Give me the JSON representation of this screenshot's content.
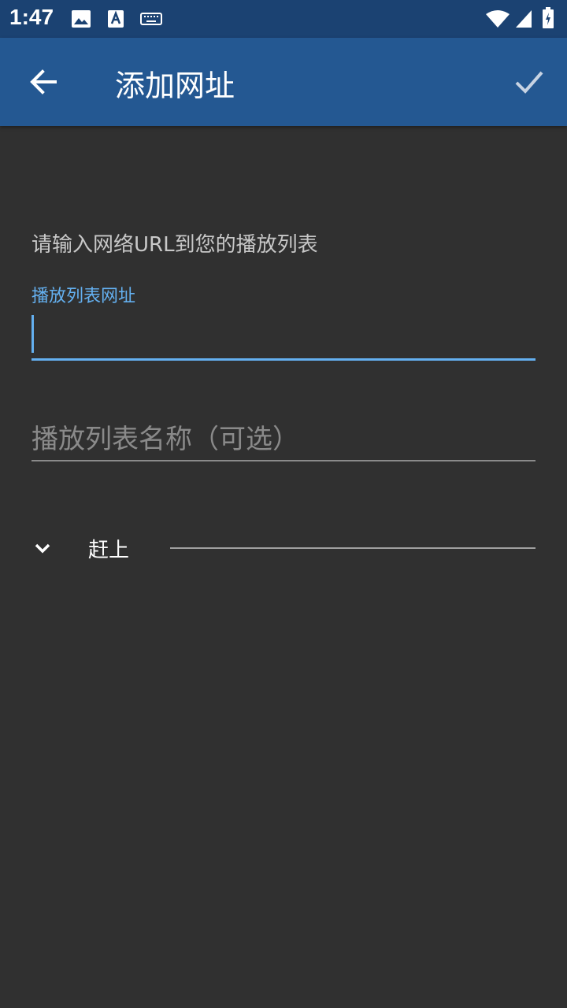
{
  "status_bar": {
    "time": "1:47",
    "icons": [
      "image-icon",
      "text-a-icon",
      "keyboard-icon",
      "wifi-icon",
      "signal-icon",
      "battery-charging-icon"
    ]
  },
  "app_bar": {
    "title": "添加网址",
    "back_icon": "arrow-left-icon",
    "confirm_icon": "check-icon"
  },
  "form": {
    "prompt": "请输入网络URL到您的播放列表",
    "url_label": "播放列表网址",
    "url_value": "",
    "name_placeholder": "播放列表名称（可选）",
    "name_value": ""
  },
  "section": {
    "label": "赶上",
    "icon": "chevron-down-icon"
  },
  "colors": {
    "status_bar": "#1b4272",
    "app_bar": "#245892",
    "background": "#303030",
    "accent": "#64b0f0"
  }
}
